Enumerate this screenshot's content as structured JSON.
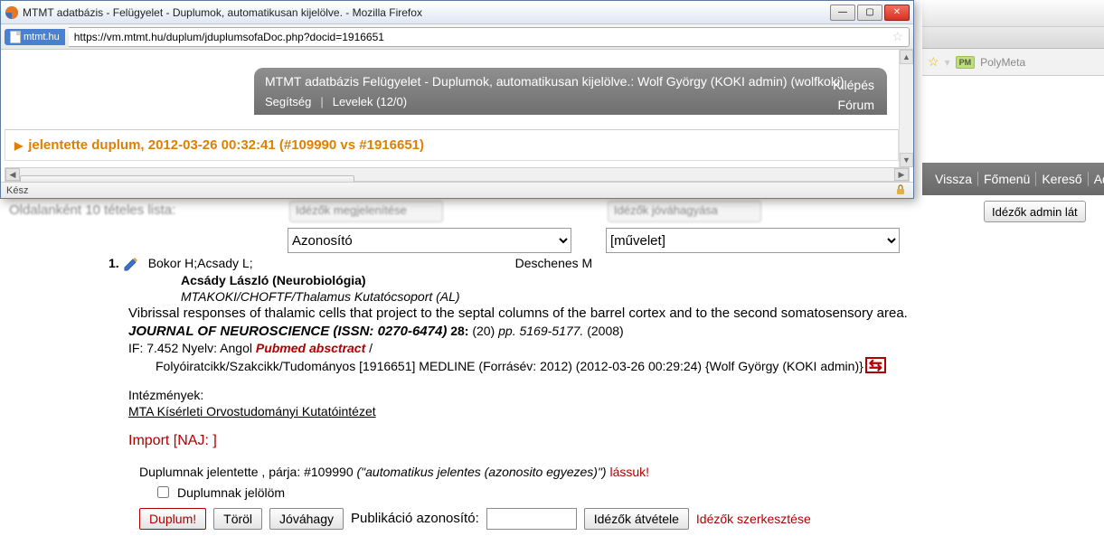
{
  "bg": {
    "nav": {
      "vissza": "Vissza",
      "fomenu": "Főmenü",
      "kereso": "Kereső",
      "ad": "Ad"
    },
    "toolbar_star": "☆",
    "polymeta_badge": "PM",
    "polymeta_label": "PolyMeta",
    "admin_btn": "Idézők admin lát",
    "blur1": "Idézők megjelenítése",
    "blur2": "Idézők jóváhagyása",
    "blurtext": "Oldalanként 10 tételes lista:",
    "dd1_selected": "Azonosító",
    "dd2_selected": "[művelet]"
  },
  "popup": {
    "title": "MTMT adatbázis - Felügyelet - Duplumok, automatikusan kijelölve. - Mozilla Firefox",
    "site": "mtmt.hu",
    "url": "https://vm.mtmt.hu/duplum/jduplumsofaDoc.php?docid=1916651",
    "banner_line1": "MTMT adatbázis Felügyelet - Duplumok, automatikusan kijelölve.: Wolf György (KOKI admin) (wolfkoki)",
    "kilepes": "Kilépés",
    "help": "Segítség",
    "levelek": "Levelek (12/0)",
    "forum": "Fórum",
    "yellow_text": "jelentette duplum, 2012-03-26 00:32:41 (#109990 vs #1916651)",
    "status": "Kész"
  },
  "entry": {
    "number": "1.",
    "authors_left": "Bokor H;Acsady L;",
    "authors_right": "Deschenes M",
    "author_bold": "Acsády László (Neurobiológia)",
    "affil": "MTAKOKI/CHOFTF/Thalamus Kutatócsoport (AL)",
    "title": "Vibrissal responses of thalamic cells that project to the septal columns of the barrel cortex and to the second somatosensory area.",
    "journal": "JOURNAL OF NEUROSCIENCE (ISSN: 0270-6474)",
    "volume": " 28:",
    "issue": " (20) ",
    "pages": "pp. 5169-5177.",
    "year": " (2008)",
    "if_line_prefix": "IF: 7.452 Nyelv: Angol ",
    "abstract_link": "Pubmed absctract",
    "if_line_suffix": " /",
    "meta": "Folyóiratcikk/Szakcikk/Tudományos [1916651] MEDLINE (Forrásév: 2012) (2012-03-26 00:29:24) {Wolf György (KOKI admin)}",
    "intezmeny_label": "Intézmények:",
    "intezmeny_link": "MTA Kísérleti Orvostudományi Kutatóintézet",
    "import_line": "Import [NAJ: ]",
    "duplum_report_text": "Duplumnak jelentette , párja: #109990 ",
    "duplum_report_note": "(\"automatikus jelentes (azonosito egyezes)\")",
    "lassuk": " lássuk!",
    "checkbox_label": "Duplumnak jelölöm",
    "btn_duplum": "Duplum!",
    "btn_torol": "Töröl",
    "btn_jovahagy": "Jóváhagy",
    "pub_id_label": "Publikáció azonosító:",
    "btn_idezok_atvetele": "Idézők átvétele",
    "citers_link": "Idézők szerkesztése"
  }
}
